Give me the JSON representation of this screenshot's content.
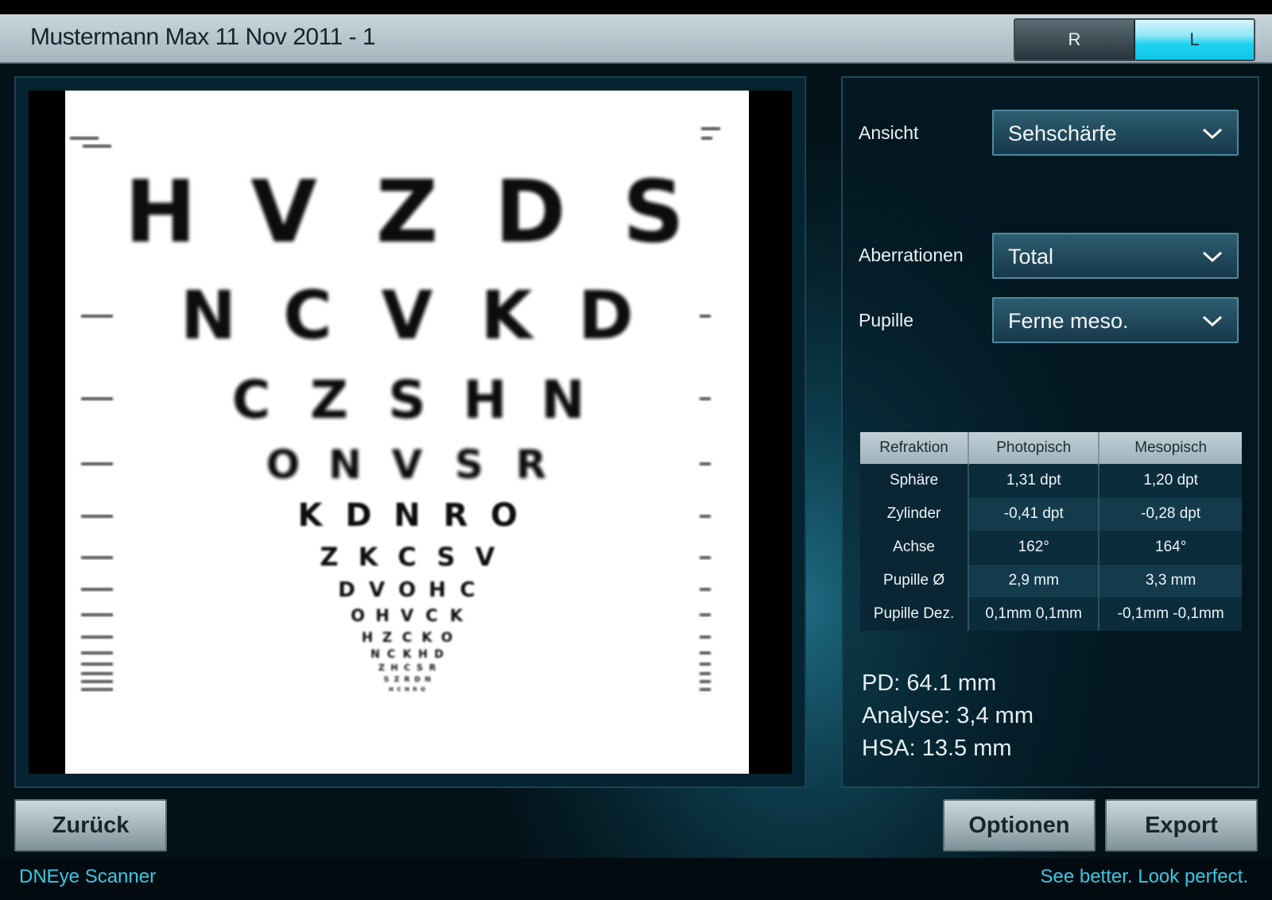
{
  "header": {
    "title": "Mustermann Max 11 Nov 2011 - 1",
    "eye_right": "R",
    "eye_left": "L",
    "active_eye": "L",
    "accent_color": "#12c5e8"
  },
  "chart": {
    "rows": [
      "H V Z D S",
      "N C V K D",
      "C Z S H N",
      "O N V S R",
      "K D N R O",
      "Z K C S V",
      "D V O H C",
      "O H V C K",
      "H Z C K O",
      "N C K H D",
      "Z H C S R",
      "S Z R D N",
      "H C N R O"
    ]
  },
  "controls": {
    "view_label": "Ansicht",
    "view_value": "Sehschärfe",
    "aberrations_label": "Aberrationen",
    "aberrations_value": "Total",
    "pupil_label": "Pupille",
    "pupil_value": "Ferne meso."
  },
  "refraction": {
    "headers": [
      "Refraktion",
      "Photopisch",
      "Mesopisch"
    ],
    "rows": [
      [
        "Sphäre",
        "1,31 dpt",
        "1,20 dpt"
      ],
      [
        "Zylinder",
        "-0,41 dpt",
        "-0,28 dpt"
      ],
      [
        "Achse",
        "162°",
        "164°"
      ],
      [
        "Pupille Ø",
        "2,9 mm",
        "3,3 mm"
      ],
      [
        "Pupille Dez.",
        "0,1mm 0,1mm",
        "-0,1mm -0,1mm"
      ]
    ]
  },
  "stats": {
    "pd": "PD: 64.1 mm",
    "analysis": "Analyse: 3,4 mm",
    "hsa": "HSA: 13.5 mm"
  },
  "buttons": {
    "back": "Zurück",
    "options": "Optionen",
    "export": "Export"
  },
  "footer": {
    "product": "DNEye Scanner",
    "slogan": "See better. Look perfect."
  }
}
